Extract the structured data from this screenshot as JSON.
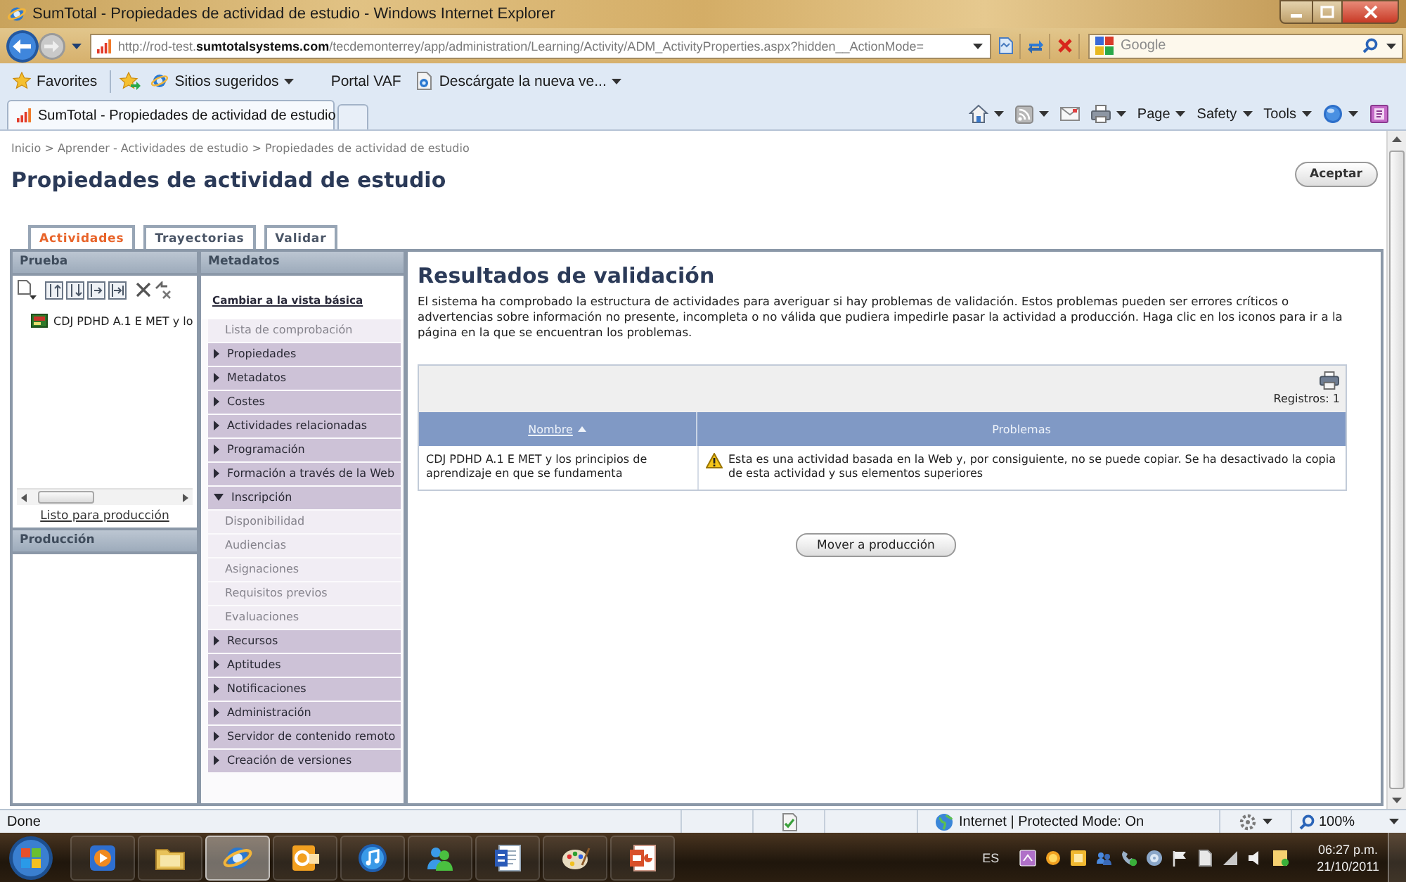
{
  "window": {
    "title": "SumTotal - Propiedades de actividad de estudio - Windows Internet Explorer"
  },
  "address_bar": {
    "url": "http://rod-test.**sumtotalsystems.com**/tecdemonterrey/app/administration/Learning/Activity/ADM_ActivityProperties.aspx?hidden__ActionMode=",
    "search": {
      "placeholder": "Google"
    }
  },
  "favorites_bar": {
    "favorites": "Favorites",
    "links": [
      {
        "kind": "icon",
        "label": "Sitios sugeridos",
        "dropdown": true
      },
      {
        "kind": "plain",
        "label": "Portal VAF",
        "dropdown": false
      },
      {
        "kind": "page",
        "label": "Descárgate la nueva ve...",
        "dropdown": true
      }
    ]
  },
  "browser_tabs": [
    {
      "title": "SumTotal - Propiedades de actividad de estudio",
      "selected": true
    }
  ],
  "command_bar": [
    {
      "kind": "home",
      "dropdown": true
    },
    {
      "kind": "feeds",
      "dropdown": true
    },
    {
      "kind": "mail",
      "dropdown": false
    },
    {
      "kind": "print",
      "dropdown": true
    },
    {
      "kind": "menu",
      "label": "Page",
      "dropdown": true
    },
    {
      "kind": "menu",
      "label": "Safety",
      "dropdown": true
    },
    {
      "kind": "menu",
      "label": "Tools",
      "dropdown": true
    },
    {
      "kind": "help",
      "dropdown": true
    },
    {
      "kind": "research",
      "dropdown": false
    }
  ],
  "page": {
    "breadcrumb": "Inicio > Aprender - Actividades de estudio > Propiedades de actividad de estudio",
    "title": "Propiedades de actividad de estudio",
    "accept_button": "Aceptar",
    "tabs": [
      {
        "label": "Actividades",
        "selected": true
      },
      {
        "label": "Trayectorias",
        "selected": false
      },
      {
        "label": "Validar",
        "selected": false
      }
    ]
  },
  "test_panel": {
    "header": "Prueba",
    "tree": [
      {
        "label": "CDJ PDHD A.1 E MET y lo"
      }
    ],
    "ready_link": "Listo para producción"
  },
  "production_panel": {
    "header": "Producción"
  },
  "metadata_panel": {
    "header": "Metadatos",
    "basic_view_link": "Cambiar a la vista básica",
    "items": [
      {
        "kind": "page",
        "label": "Lista de comprobación"
      },
      {
        "kind": "section",
        "label": "Propiedades",
        "expanded": false
      },
      {
        "kind": "section",
        "label": "Metadatos",
        "expanded": false
      },
      {
        "kind": "section",
        "label": "Costes",
        "expanded": false
      },
      {
        "kind": "section",
        "label": "Actividades relacionadas",
        "expanded": false
      },
      {
        "kind": "section",
        "label": "Programación",
        "expanded": false
      },
      {
        "kind": "section",
        "label": "Formación a través de la Web",
        "expanded": false
      },
      {
        "kind": "section",
        "label": "Inscripción",
        "expanded": true,
        "children": [
          {
            "kind": "page",
            "label": "Disponibilidad"
          },
          {
            "kind": "page",
            "label": "Audiencias"
          },
          {
            "kind": "page",
            "label": "Asignaciones"
          },
          {
            "kind": "page",
            "label": "Requisitos previos"
          },
          {
            "kind": "page",
            "label": "Evaluaciones"
          }
        ]
      },
      {
        "kind": "section",
        "label": "Recursos",
        "expanded": false
      },
      {
        "kind": "section",
        "label": "Aptitudes",
        "expanded": false
      },
      {
        "kind": "section",
        "label": "Notificaciones",
        "expanded": false
      },
      {
        "kind": "section",
        "label": "Administración",
        "expanded": false
      },
      {
        "kind": "section",
        "label": "Servidor de contenido remoto",
        "expanded": false
      },
      {
        "kind": "section",
        "label": "Creación de versiones",
        "expanded": false
      }
    ]
  },
  "results": {
    "title": "Resultados de validación",
    "description": "El sistema ha comprobado la estructura de actividades para averiguar si hay problemas de validación. Estos problemas pueden ser errores críticos o advertencias sobre información no presente, incompleta o no válida que pudiera impedirle pasar la actividad a producción. Haga clic en los iconos para ir a la página en la que se encuentran los problemas.",
    "record_count": "Registros: 1",
    "columns": [
      {
        "label": "Nombre",
        "sortable": true,
        "sorted": true
      },
      {
        "label": "Problemas",
        "sortable": false,
        "sorted": false
      }
    ],
    "rows": [
      {
        "name": "CDJ PDHD A.1 E MET y los principios de aprendizaje en que se fundamenta",
        "kind": "warning",
        "problem": "Esta es una actividad basada en la Web y, por consiguiente, no se puede copiar. Se ha desactivado la copia de esta actividad y sus elementos superiores"
      }
    ],
    "move_button": "Mover a producción"
  },
  "status_bar": {
    "text": "Done",
    "zone": "Internet | Protected Mode: On",
    "zoom": "100%"
  },
  "taskbar": {
    "apps": [
      {
        "kind": "media",
        "selected": false
      },
      {
        "kind": "folder",
        "selected": false
      },
      {
        "kind": "browser",
        "selected": true
      },
      {
        "kind": "mail",
        "selected": false
      },
      {
        "kind": "music",
        "selected": false
      },
      {
        "kind": "chat",
        "selected": false
      },
      {
        "kind": "document",
        "selected": false
      },
      {
        "kind": "paint",
        "selected": false
      },
      {
        "kind": "slides",
        "selected": false
      }
    ],
    "language": "ES",
    "time": "06:27 p.m.",
    "date": "21/10/2011"
  }
}
